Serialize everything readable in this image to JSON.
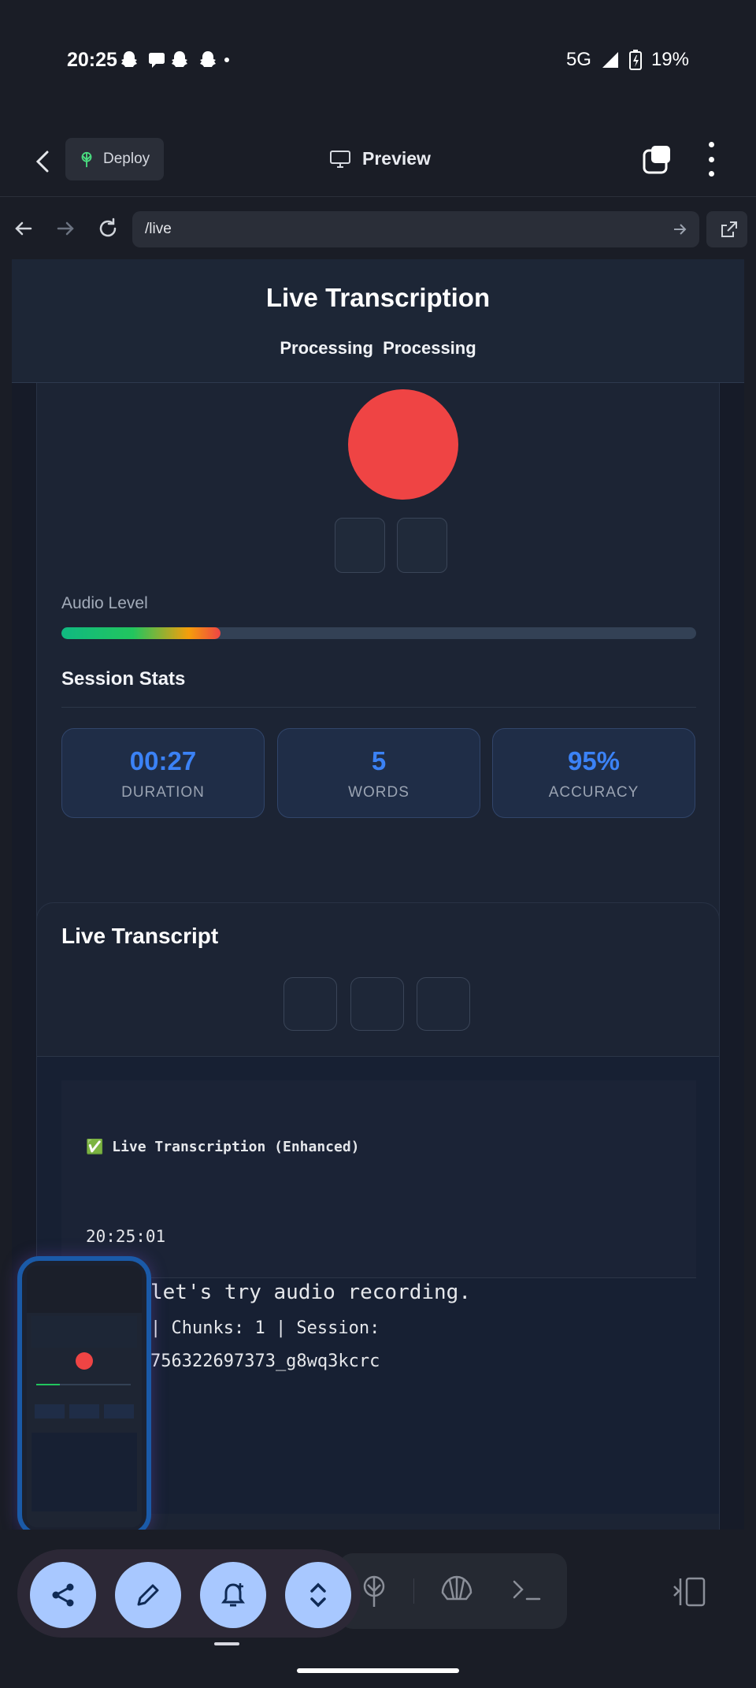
{
  "status_bar": {
    "time": "20:25",
    "notification_icons": [
      "snapchat-icon",
      "chat-icon",
      "snapchat-icon",
      "snapchat-icon",
      "dot-icon"
    ],
    "network": "5G",
    "battery": "19%"
  },
  "top_bar": {
    "deploy_label": "Deploy",
    "preview_label": "Preview"
  },
  "url_bar": {
    "url": "/live"
  },
  "page": {
    "title": "Live Transcription",
    "status_1": "Processing",
    "status_2": "Processing",
    "audio_level_label": "Audio Level",
    "audio_level": 0.25,
    "session_stats_title": "Session Stats",
    "stats": [
      {
        "value": "00:27",
        "label": "DURATION"
      },
      {
        "value": "5",
        "label": "WORDS"
      },
      {
        "value": "95%",
        "label": "ACCURACY"
      }
    ],
    "transcript_title": "Live Transcript",
    "transcript": {
      "header": "✅ Live Transcription (Enhanced)",
      "time": "20:25:01",
      "line1": "let's try audio recording.",
      "line2": "| Chunks: 1 | Session:",
      "line3": "756322697373_g8wq3kcrc"
    }
  },
  "colors": {
    "accent": "#3b82f6",
    "record": "#ef4444",
    "fab": "#a8c8ff"
  },
  "fab_icons": [
    "share-icon",
    "edit-icon",
    "add-alarm-icon",
    "expand-icon"
  ],
  "bottom_icons": [
    "deploy-icon",
    "shell-icon",
    "terminal-icon",
    "split-view-icon"
  ]
}
